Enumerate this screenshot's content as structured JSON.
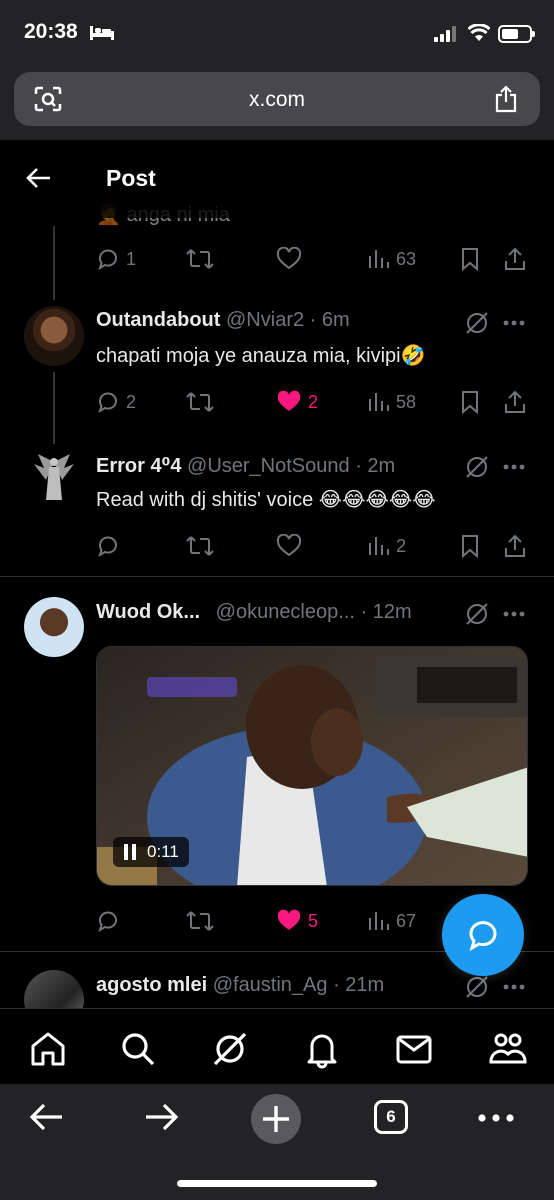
{
  "status_bar": {
    "time": "20:38"
  },
  "browser": {
    "url": "x.com",
    "tabs_count": "6"
  },
  "header": {
    "title": "Post"
  },
  "tweets": [
    {
      "partial_text": "🤦 anga ni mia",
      "reply_count": "1",
      "retweet_count": "",
      "like_count": "",
      "view_count": "63"
    },
    {
      "name": "Outandabout",
      "handle": "@Nviar2",
      "time": "· 6m",
      "text": "chapati moja ye anauza mia, kivipi🤣",
      "reply_count": "2",
      "retweet_count": "",
      "like_count": "2",
      "liked": true,
      "view_count": "58"
    },
    {
      "name": "Error 4⁰4",
      "handle": "@User_NotSound",
      "time": "· 2m",
      "text": "Read  with  dj  shitis' voice 😂😂😂😂😂",
      "reply_count": "",
      "retweet_count": "",
      "like_count": "",
      "view_count": "2"
    },
    {
      "name": "Wuod Ok...",
      "handle": "@okunecleop...",
      "time": "· 12m",
      "video_time": "0:11",
      "reply_count": "",
      "retweet_count": "",
      "like_count": "5",
      "liked": true,
      "view_count": "67"
    },
    {
      "name": "agosto mlei",
      "handle": "@faustin_Ag",
      "time": "· 21m"
    }
  ],
  "colors": {
    "background": "#000000",
    "accent": "#1d9bf0",
    "like": "#f91880",
    "muted": "#71767b"
  },
  "icons": {
    "nav": [
      "home-icon",
      "search-icon",
      "grok-icon",
      "notifications-icon",
      "messages-icon",
      "communities-icon"
    ],
    "safari": [
      "back-icon",
      "forward-icon",
      "new-tab-icon",
      "tabs-icon",
      "more-icon"
    ]
  }
}
